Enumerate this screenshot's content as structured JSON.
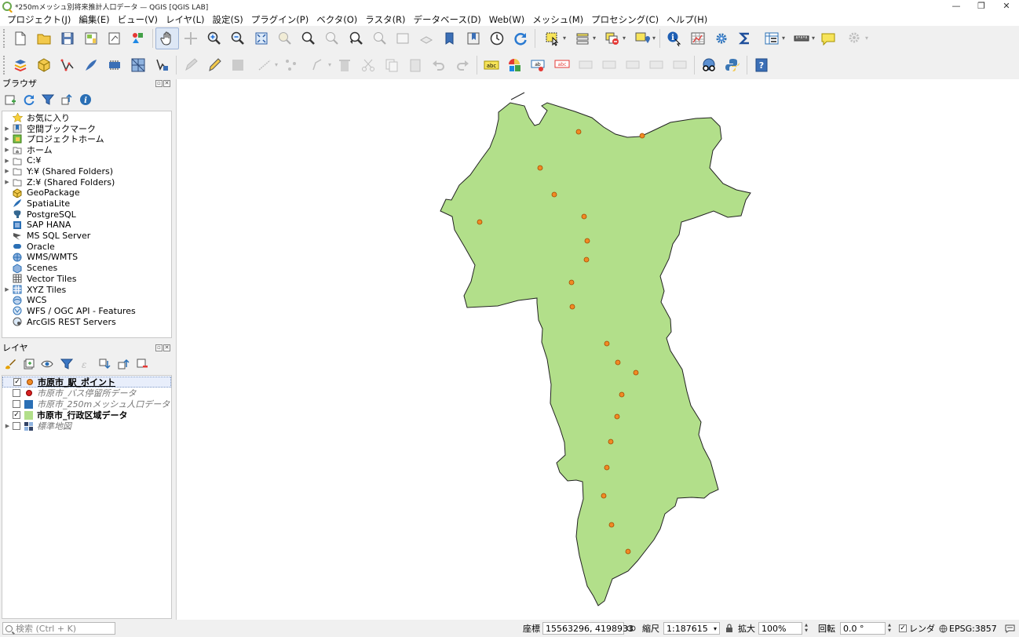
{
  "window": {
    "title": "*250mメッシュ別将来推計人口データ — QGIS [QGIS LAB]",
    "minimize": "—",
    "maximize": "❐",
    "close": "✕"
  },
  "menu": [
    "プロジェクト(J)",
    "編集(E)",
    "ビュー(V)",
    "レイヤ(L)",
    "設定(S)",
    "プラグイン(P)",
    "ベクタ(O)",
    "ラスタ(R)",
    "データベース(D)",
    "Web(W)",
    "メッシュ(M)",
    "プロセシング(C)",
    "ヘルプ(H)"
  ],
  "browser_panel": {
    "title": "ブラウザ",
    "items": [
      {
        "label": "お気に入り",
        "expandable": false,
        "icon": "star-icon"
      },
      {
        "label": "空間ブックマーク",
        "expandable": true,
        "icon": "bookmark-icon"
      },
      {
        "label": "プロジェクトホーム",
        "expandable": true,
        "icon": "project-home-icon"
      },
      {
        "label": "ホーム",
        "expandable": true,
        "icon": "home-folder-icon"
      },
      {
        "label": "C:¥",
        "expandable": true,
        "icon": "folder-icon"
      },
      {
        "label": "Y:¥ (Shared Folders)",
        "expandable": true,
        "icon": "folder-icon"
      },
      {
        "label": "Z:¥ (Shared Folders)",
        "expandable": true,
        "icon": "folder-icon"
      },
      {
        "label": "GeoPackage",
        "expandable": false,
        "icon": "geopackage-icon"
      },
      {
        "label": "SpatiaLite",
        "expandable": false,
        "icon": "spatialite-icon"
      },
      {
        "label": "PostgreSQL",
        "expandable": false,
        "icon": "postgresql-icon"
      },
      {
        "label": "SAP HANA",
        "expandable": false,
        "icon": "sap-hana-icon"
      },
      {
        "label": "MS SQL Server",
        "expandable": false,
        "icon": "mssql-icon"
      },
      {
        "label": "Oracle",
        "expandable": false,
        "icon": "oracle-icon"
      },
      {
        "label": "WMS/WMTS",
        "expandable": false,
        "icon": "wms-icon"
      },
      {
        "label": "Scenes",
        "expandable": false,
        "icon": "scenes-icon"
      },
      {
        "label": "Vector Tiles",
        "expandable": false,
        "icon": "vector-tiles-icon"
      },
      {
        "label": "XYZ Tiles",
        "expandable": true,
        "icon": "xyz-tiles-icon"
      },
      {
        "label": "WCS",
        "expandable": false,
        "icon": "wcs-icon"
      },
      {
        "label": "WFS / OGC API - Features",
        "expandable": false,
        "icon": "wfs-icon"
      },
      {
        "label": "ArcGIS REST Servers",
        "expandable": false,
        "icon": "arcgis-icon"
      }
    ]
  },
  "layers_panel": {
    "title": "レイヤ",
    "layers": [
      {
        "name": "市原市_駅_ポイント",
        "checked": true,
        "symbol": "orange-point",
        "color": "#f08a24",
        "style": "bold",
        "selected": true,
        "expandable": false
      },
      {
        "name": "市原市_バス停留所データ",
        "checked": false,
        "symbol": "red-point",
        "color": "#d62020",
        "style": "italic",
        "selected": false,
        "expandable": false
      },
      {
        "name": "市原市_250mメッシュ人口データ",
        "checked": false,
        "symbol": "blue-square",
        "color": "#2a6fb5",
        "style": "italic",
        "selected": false,
        "expandable": false
      },
      {
        "name": "市原市_行政区域データ",
        "checked": true,
        "symbol": "green-square",
        "color": "#b2df8a",
        "style": "bold",
        "selected": false,
        "expandable": false
      },
      {
        "name": "標準地図",
        "checked": false,
        "symbol": "raster-tiles",
        "color": "#334466",
        "style": "italic",
        "selected": false,
        "expandable": true
      }
    ]
  },
  "map": {
    "polygon_fill": "#b2df8a",
    "polygon_stroke": "#222222",
    "point_fill": "#f08a24",
    "point_stroke": "#a34a00"
  },
  "statusbar": {
    "search_placeholder": "検索 (Ctrl + K)",
    "coordinate_label": "座標",
    "coordinate_value": "15563296, 4198933",
    "scale_label": "縮尺",
    "scale_value": "1:187615",
    "magnifier_label": "拡大",
    "magnifier_value": "100%",
    "rotation_label": "回転",
    "rotation_value": "0.0 °",
    "render_label": "レンダ",
    "render_checked": true,
    "crs_value": "EPSG:3857"
  }
}
